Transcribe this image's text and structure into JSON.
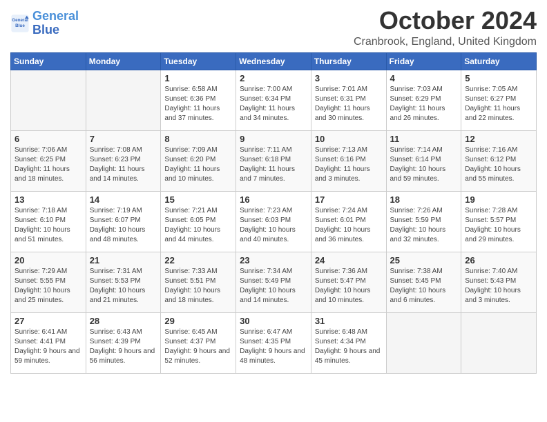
{
  "header": {
    "logo_line1": "General",
    "logo_line2": "Blue",
    "month_title": "October 2024",
    "location": "Cranbrook, England, United Kingdom"
  },
  "weekdays": [
    "Sunday",
    "Monday",
    "Tuesday",
    "Wednesday",
    "Thursday",
    "Friday",
    "Saturday"
  ],
  "weeks": [
    [
      {
        "day": "",
        "info": ""
      },
      {
        "day": "",
        "info": ""
      },
      {
        "day": "1",
        "info": "Sunrise: 6:58 AM\nSunset: 6:36 PM\nDaylight: 11 hours and 37 minutes."
      },
      {
        "day": "2",
        "info": "Sunrise: 7:00 AM\nSunset: 6:34 PM\nDaylight: 11 hours and 34 minutes."
      },
      {
        "day": "3",
        "info": "Sunrise: 7:01 AM\nSunset: 6:31 PM\nDaylight: 11 hours and 30 minutes."
      },
      {
        "day": "4",
        "info": "Sunrise: 7:03 AM\nSunset: 6:29 PM\nDaylight: 11 hours and 26 minutes."
      },
      {
        "day": "5",
        "info": "Sunrise: 7:05 AM\nSunset: 6:27 PM\nDaylight: 11 hours and 22 minutes."
      }
    ],
    [
      {
        "day": "6",
        "info": "Sunrise: 7:06 AM\nSunset: 6:25 PM\nDaylight: 11 hours and 18 minutes."
      },
      {
        "day": "7",
        "info": "Sunrise: 7:08 AM\nSunset: 6:23 PM\nDaylight: 11 hours and 14 minutes."
      },
      {
        "day": "8",
        "info": "Sunrise: 7:09 AM\nSunset: 6:20 PM\nDaylight: 11 hours and 10 minutes."
      },
      {
        "day": "9",
        "info": "Sunrise: 7:11 AM\nSunset: 6:18 PM\nDaylight: 11 hours and 7 minutes."
      },
      {
        "day": "10",
        "info": "Sunrise: 7:13 AM\nSunset: 6:16 PM\nDaylight: 11 hours and 3 minutes."
      },
      {
        "day": "11",
        "info": "Sunrise: 7:14 AM\nSunset: 6:14 PM\nDaylight: 10 hours and 59 minutes."
      },
      {
        "day": "12",
        "info": "Sunrise: 7:16 AM\nSunset: 6:12 PM\nDaylight: 10 hours and 55 minutes."
      }
    ],
    [
      {
        "day": "13",
        "info": "Sunrise: 7:18 AM\nSunset: 6:10 PM\nDaylight: 10 hours and 51 minutes."
      },
      {
        "day": "14",
        "info": "Sunrise: 7:19 AM\nSunset: 6:07 PM\nDaylight: 10 hours and 48 minutes."
      },
      {
        "day": "15",
        "info": "Sunrise: 7:21 AM\nSunset: 6:05 PM\nDaylight: 10 hours and 44 minutes."
      },
      {
        "day": "16",
        "info": "Sunrise: 7:23 AM\nSunset: 6:03 PM\nDaylight: 10 hours and 40 minutes."
      },
      {
        "day": "17",
        "info": "Sunrise: 7:24 AM\nSunset: 6:01 PM\nDaylight: 10 hours and 36 minutes."
      },
      {
        "day": "18",
        "info": "Sunrise: 7:26 AM\nSunset: 5:59 PM\nDaylight: 10 hours and 32 minutes."
      },
      {
        "day": "19",
        "info": "Sunrise: 7:28 AM\nSunset: 5:57 PM\nDaylight: 10 hours and 29 minutes."
      }
    ],
    [
      {
        "day": "20",
        "info": "Sunrise: 7:29 AM\nSunset: 5:55 PM\nDaylight: 10 hours and 25 minutes."
      },
      {
        "day": "21",
        "info": "Sunrise: 7:31 AM\nSunset: 5:53 PM\nDaylight: 10 hours and 21 minutes."
      },
      {
        "day": "22",
        "info": "Sunrise: 7:33 AM\nSunset: 5:51 PM\nDaylight: 10 hours and 18 minutes."
      },
      {
        "day": "23",
        "info": "Sunrise: 7:34 AM\nSunset: 5:49 PM\nDaylight: 10 hours and 14 minutes."
      },
      {
        "day": "24",
        "info": "Sunrise: 7:36 AM\nSunset: 5:47 PM\nDaylight: 10 hours and 10 minutes."
      },
      {
        "day": "25",
        "info": "Sunrise: 7:38 AM\nSunset: 5:45 PM\nDaylight: 10 hours and 6 minutes."
      },
      {
        "day": "26",
        "info": "Sunrise: 7:40 AM\nSunset: 5:43 PM\nDaylight: 10 hours and 3 minutes."
      }
    ],
    [
      {
        "day": "27",
        "info": "Sunrise: 6:41 AM\nSunset: 4:41 PM\nDaylight: 9 hours and 59 minutes."
      },
      {
        "day": "28",
        "info": "Sunrise: 6:43 AM\nSunset: 4:39 PM\nDaylight: 9 hours and 56 minutes."
      },
      {
        "day": "29",
        "info": "Sunrise: 6:45 AM\nSunset: 4:37 PM\nDaylight: 9 hours and 52 minutes."
      },
      {
        "day": "30",
        "info": "Sunrise: 6:47 AM\nSunset: 4:35 PM\nDaylight: 9 hours and 48 minutes."
      },
      {
        "day": "31",
        "info": "Sunrise: 6:48 AM\nSunset: 4:34 PM\nDaylight: 9 hours and 45 minutes."
      },
      {
        "day": "",
        "info": ""
      },
      {
        "day": "",
        "info": ""
      }
    ]
  ]
}
